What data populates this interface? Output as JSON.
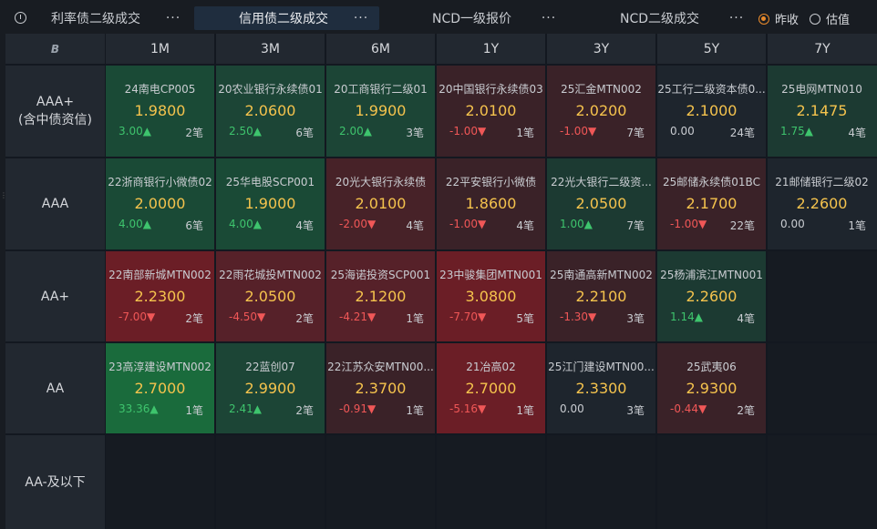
{
  "tabs": [
    {
      "label": "利率债二级成交",
      "active": false
    },
    {
      "label": "信用债二级成交",
      "active": true
    },
    {
      "label": "NCD一级报价",
      "active": false
    },
    {
      "label": "NCD二级成交",
      "active": false
    }
  ],
  "more_label": "···",
  "radio": [
    {
      "label": "昨收",
      "checked": true
    },
    {
      "label": "估值",
      "checked": false
    }
  ],
  "table": {
    "corner_icon": "brand-logo-icon",
    "columns": [
      "1M",
      "3M",
      "6M",
      "1Y",
      "3Y",
      "5Y",
      "7Y"
    ],
    "rows": [
      {
        "label_line1": "AAA+",
        "label_line2": "(含中债资信)",
        "cells": [
          {
            "name": "24南电CP005",
            "rate": "1.9800",
            "change": "3.00▲",
            "dir": "up",
            "count": "2笔",
            "bg": "#1a4a36"
          },
          {
            "name": "20农业银行永续债01",
            "rate": "2.0600",
            "change": "2.50▲",
            "dir": "up",
            "count": "6笔",
            "bg": "#1c4536"
          },
          {
            "name": "20工商银行二级01",
            "rate": "1.9900",
            "change": "2.00▲",
            "dir": "up",
            "count": "3笔",
            "bg": "#1c4536"
          },
          {
            "name": "20中国银行永续债03",
            "rate": "2.0100",
            "change": "-1.00▼",
            "dir": "down",
            "count": "1笔",
            "bg": "#3a2228"
          },
          {
            "name": "25汇金MTN002",
            "rate": "2.0200",
            "change": "-1.00▼",
            "dir": "down",
            "count": "7笔",
            "bg": "#3a2228"
          },
          {
            "name": "25工行二级资本债0...",
            "rate": "2.1000",
            "change": "0.00",
            "dir": "flat",
            "count": "24笔",
            "bg": "#1e252d"
          },
          {
            "name": "25电网MTN010",
            "rate": "2.1475",
            "change": "1.75▲",
            "dir": "up",
            "count": "4笔",
            "bg": "#1c3a32"
          }
        ]
      },
      {
        "label_line1": "AAA",
        "label_line2": "",
        "cells": [
          {
            "name": "22浙商银行小微债02",
            "rate": "2.0000",
            "change": "4.00▲",
            "dir": "up",
            "count": "6笔",
            "bg": "#1a4a36"
          },
          {
            "name": "25华电股SCP001",
            "rate": "1.9000",
            "change": "4.00▲",
            "dir": "up",
            "count": "4笔",
            "bg": "#1a4a36"
          },
          {
            "name": "20光大银行永续债",
            "rate": "2.0100",
            "change": "-2.00▼",
            "dir": "down",
            "count": "4笔",
            "bg": "#472228"
          },
          {
            "name": "22平安银行小微债",
            "rate": "1.8600",
            "change": "-1.00▼",
            "dir": "down",
            "count": "4笔",
            "bg": "#3a2228"
          },
          {
            "name": "22光大银行二级资...",
            "rate": "2.0500",
            "change": "1.00▲",
            "dir": "up",
            "count": "7笔",
            "bg": "#1c3a32"
          },
          {
            "name": "25邮储永续债01BC",
            "rate": "2.1700",
            "change": "-1.00▼",
            "dir": "down",
            "count": "22笔",
            "bg": "#3a2228"
          },
          {
            "name": "21邮储银行二级02",
            "rate": "2.2600",
            "change": "0.00",
            "dir": "flat",
            "count": "1笔",
            "bg": "#1e252d"
          }
        ]
      },
      {
        "label_line1": "AA+",
        "label_line2": "",
        "cells": [
          {
            "name": "22南部新城MTN002",
            "rate": "2.2300",
            "change": "-7.00▼",
            "dir": "down",
            "count": "2笔",
            "bg": "#6b1e26"
          },
          {
            "name": "22雨花城投MTN002",
            "rate": "2.0500",
            "change": "-4.50▼",
            "dir": "down",
            "count": "2笔",
            "bg": "#562129"
          },
          {
            "name": "25海诺投资SCP001",
            "rate": "2.1200",
            "change": "-4.21▼",
            "dir": "down",
            "count": "1笔",
            "bg": "#562129"
          },
          {
            "name": "23中骏集团MTN001",
            "rate": "3.0800",
            "change": "-7.70▼",
            "dir": "down",
            "count": "5笔",
            "bg": "#6b1e26"
          },
          {
            "name": "25南通高新MTN002",
            "rate": "2.2100",
            "change": "-1.30▼",
            "dir": "down",
            "count": "3笔",
            "bg": "#3a2228"
          },
          {
            "name": "25杨浦滨江MTN001",
            "rate": "2.2600",
            "change": "1.14▲",
            "dir": "up",
            "count": "4笔",
            "bg": "#1c3a32"
          },
          null
        ]
      },
      {
        "label_line1": "AA",
        "label_line2": "",
        "cells": [
          {
            "name": "23高淳建设MTN002",
            "rate": "2.7000",
            "change": "33.36▲",
            "dir": "up",
            "count": "1笔",
            "bg": "#1a6b3c"
          },
          {
            "name": "22蓝创07",
            "rate": "2.9900",
            "change": "2.41▲",
            "dir": "up",
            "count": "2笔",
            "bg": "#1c4536"
          },
          {
            "name": "22江苏众安MTN00...",
            "rate": "2.3700",
            "change": "-0.91▼",
            "dir": "down",
            "count": "1笔",
            "bg": "#3a2228"
          },
          {
            "name": "21冶高02",
            "rate": "2.7000",
            "change": "-5.16▼",
            "dir": "down",
            "count": "1笔",
            "bg": "#6b1e26"
          },
          {
            "name": "25江门建设MTN00...",
            "rate": "2.3300",
            "change": "0.00",
            "dir": "flat",
            "count": "3笔",
            "bg": "#1e252d"
          },
          {
            "name": "25武夷06",
            "rate": "2.9300",
            "change": "-0.44▼",
            "dir": "down",
            "count": "2笔",
            "bg": "#3a2228"
          },
          null
        ]
      },
      {
        "label_line1": "AA-及以下",
        "label_line2": "",
        "cells": [
          null,
          null,
          null,
          null,
          null,
          null,
          null
        ]
      }
    ]
  }
}
